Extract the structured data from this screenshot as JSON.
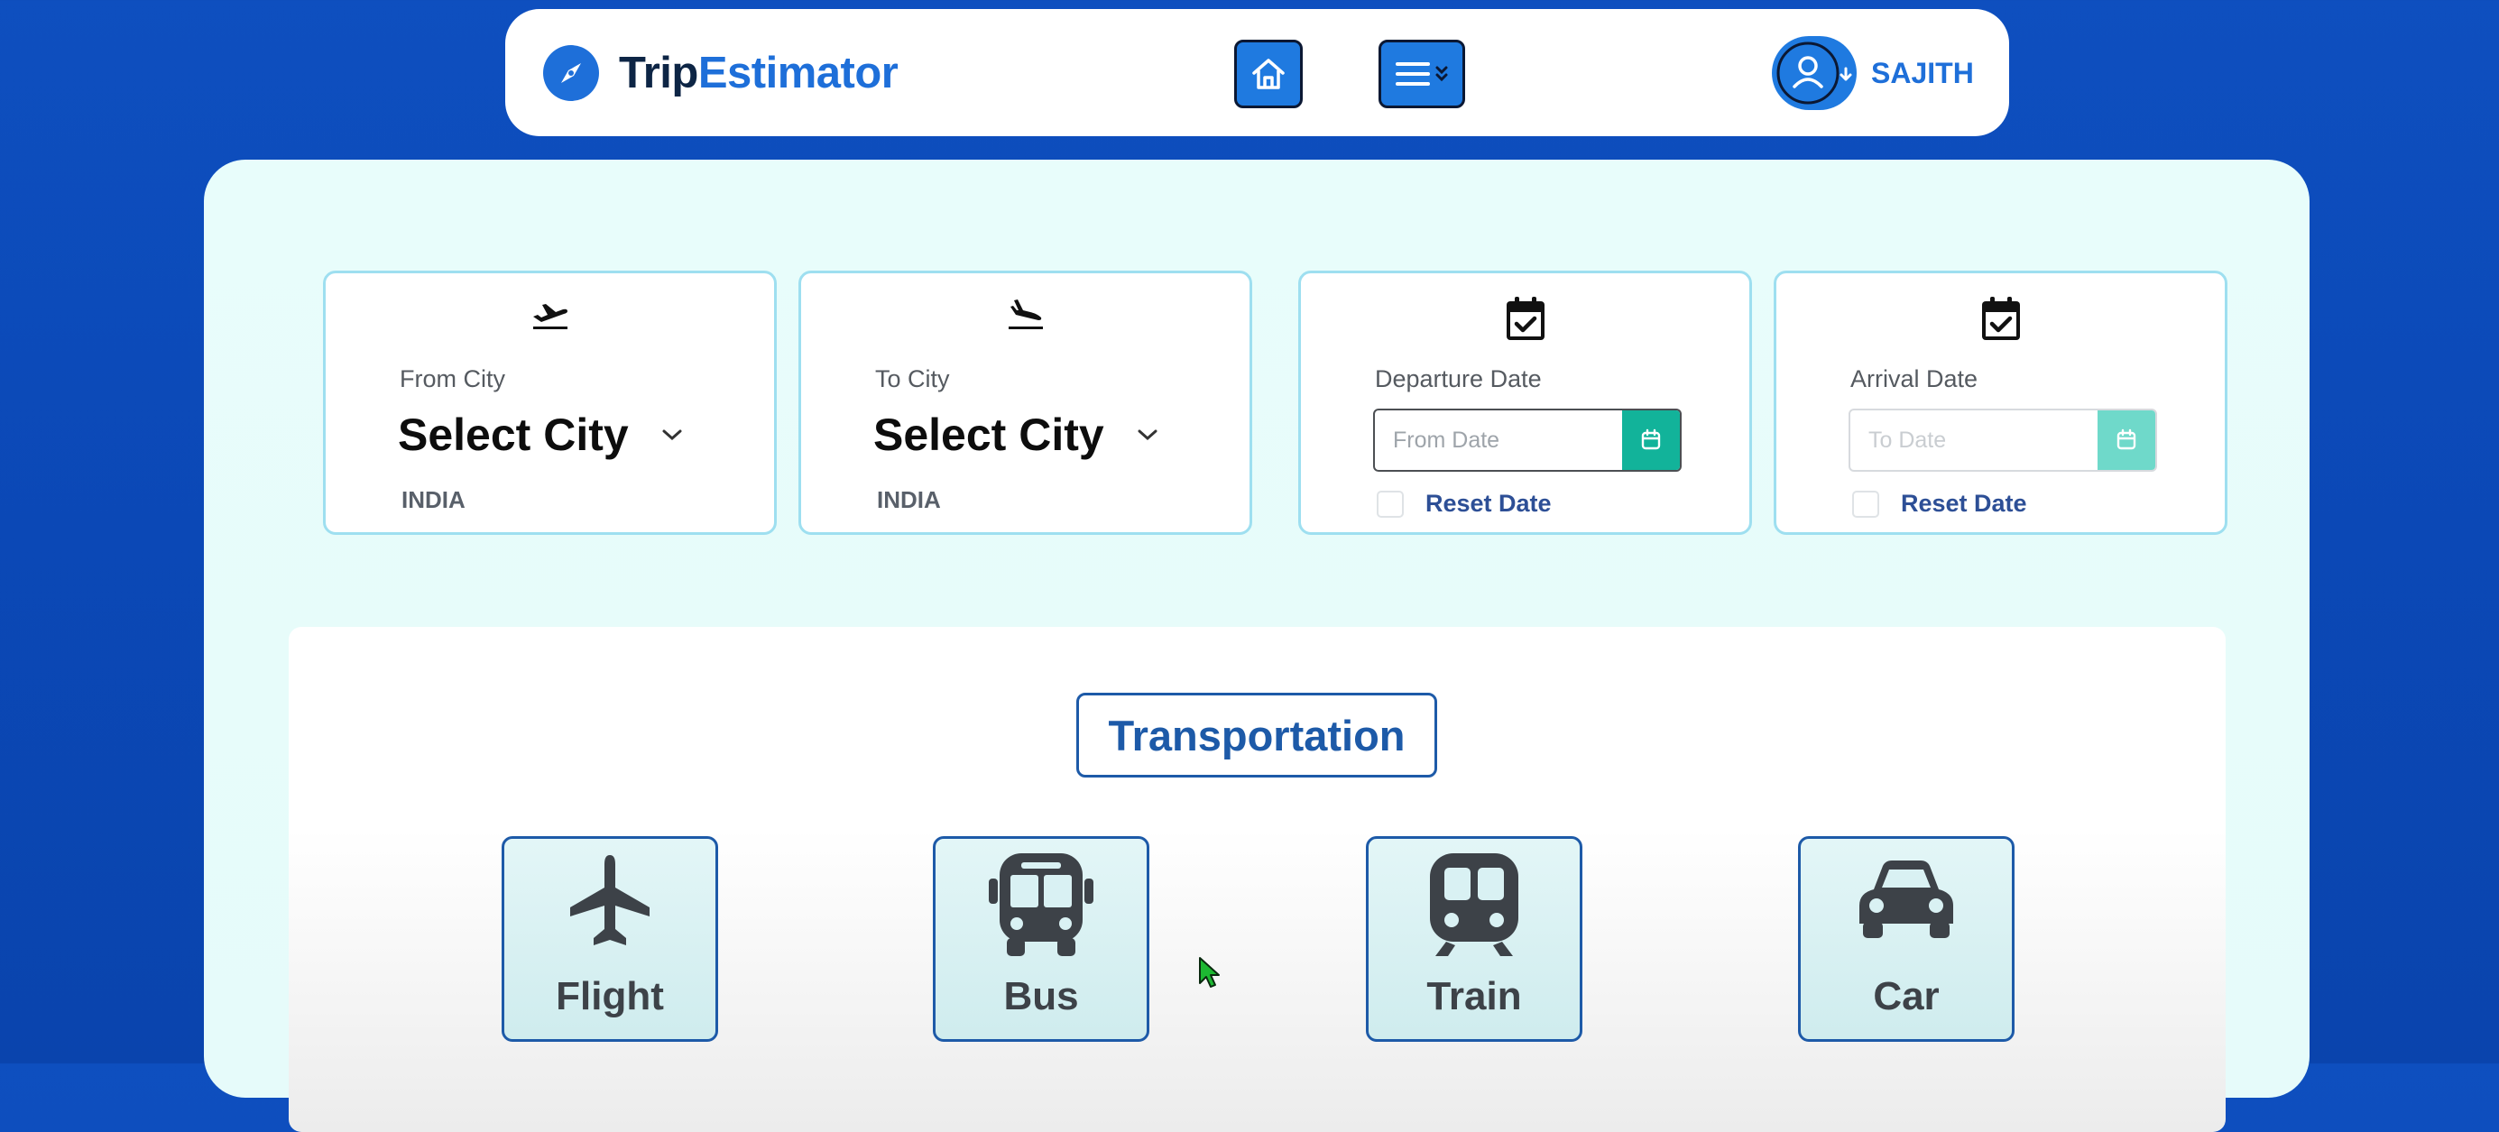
{
  "brand": {
    "part1": "Trip",
    "part2": "Estimator",
    "logo_icon": "compass-icon"
  },
  "nav": {
    "home_icon": "home-icon",
    "menu_icon": "menu-icon"
  },
  "user": {
    "name": "SAJITH",
    "avatar_icon": "user-icon"
  },
  "from_city": {
    "label": "From City",
    "value": "Select City",
    "country": "INDIA",
    "icon": "plane-departure-icon"
  },
  "to_city": {
    "label": "To City",
    "value": "Select City",
    "country": "INDIA",
    "icon": "plane-arrival-icon"
  },
  "departure": {
    "label": "Departure Date",
    "placeholder": "From Date",
    "reset_label": "Reset Date",
    "icon": "calendar-check-icon"
  },
  "arrival": {
    "label": "Arrival Date",
    "placeholder": "To Date",
    "reset_label": "Reset Date",
    "icon": "calendar-check-icon"
  },
  "transport": {
    "title": "Transportation",
    "modes": [
      {
        "label": "Flight",
        "icon": "plane-icon"
      },
      {
        "label": "Bus",
        "icon": "bus-icon"
      },
      {
        "label": "Train",
        "icon": "train-icon"
      },
      {
        "label": "Car",
        "icon": "car-icon"
      }
    ]
  },
  "colors": {
    "accent": "#1f7ae0",
    "teal": "#12b39a",
    "title_blue": "#1d5aa8",
    "background": "#0b48b6"
  }
}
